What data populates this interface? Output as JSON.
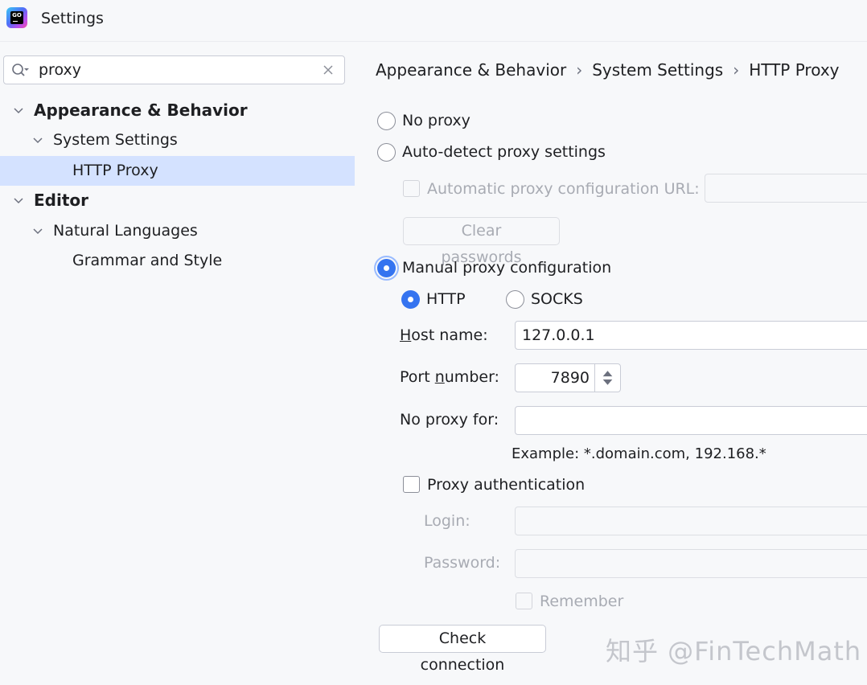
{
  "window": {
    "title": "Settings"
  },
  "search": {
    "value": "proxy"
  },
  "tree": [
    {
      "label": "Appearance & Behavior"
    },
    {
      "label": "System Settings"
    },
    {
      "label": "HTTP Proxy"
    },
    {
      "label": "Editor"
    },
    {
      "label": "Natural Languages"
    },
    {
      "label": "Grammar and Style"
    }
  ],
  "breadcrumb": [
    "Appearance & Behavior",
    "System Settings",
    "HTTP Proxy"
  ],
  "breadcrumb_separator": "›",
  "proxy": {
    "no_proxy": "No proxy",
    "auto_detect": "Auto-detect proxy settings",
    "auto_config_url": "Automatic proxy configuration URL:",
    "clear_passwords": "Clear passwords",
    "manual": "Manual proxy configuration",
    "http": "HTTP",
    "socks": "SOCKS",
    "host_label_first": "H",
    "host_label_rest": "ost name:",
    "host_value": "127.0.0.1",
    "port_label_start": "Port ",
    "port_label_mnemonic": "n",
    "port_label_end": "umber:",
    "port_value": "7890",
    "no_proxy_for": "No proxy for:",
    "no_proxy_for_value": "",
    "example": "Example: *.domain.com, 192.168.*",
    "auth": "Proxy authentication",
    "login": "Login:",
    "password": "Password:",
    "remember": "Remember",
    "check_connection": "Check connection",
    "selected_mode": "manual",
    "selected_protocol": "http"
  },
  "watermark": "知乎 @FinTechMath",
  "colors": {
    "accent": "#3574f0",
    "selection": "#d4e2ff",
    "background": "#f7f8fa"
  }
}
